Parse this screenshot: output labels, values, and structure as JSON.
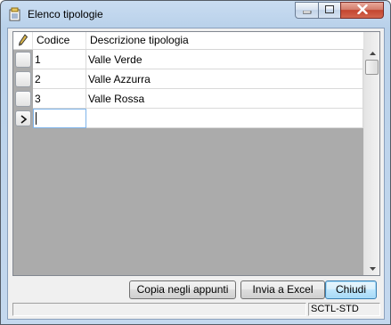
{
  "window": {
    "title": "Elenco tipologie"
  },
  "grid": {
    "columns": [
      "Codice",
      "Descrizione tipologia"
    ],
    "rows": [
      {
        "codice": "1",
        "descrizione": "Valle Verde"
      },
      {
        "codice": "2",
        "descrizione": "Valle Azzurra"
      },
      {
        "codice": "3",
        "descrizione": "Valle Rossa"
      }
    ],
    "new_row": {
      "codice": "",
      "descrizione": ""
    }
  },
  "buttons": {
    "copy": "Copia negli appunti",
    "excel": "Invia a Excel",
    "close": "Chiudi"
  },
  "status": {
    "left": "",
    "right": "SCTL-STD"
  },
  "icons": {
    "app": "notepad-list-icon",
    "header_edit": "pencil-icon",
    "new_row_indicator": "chevron-right-icon"
  }
}
